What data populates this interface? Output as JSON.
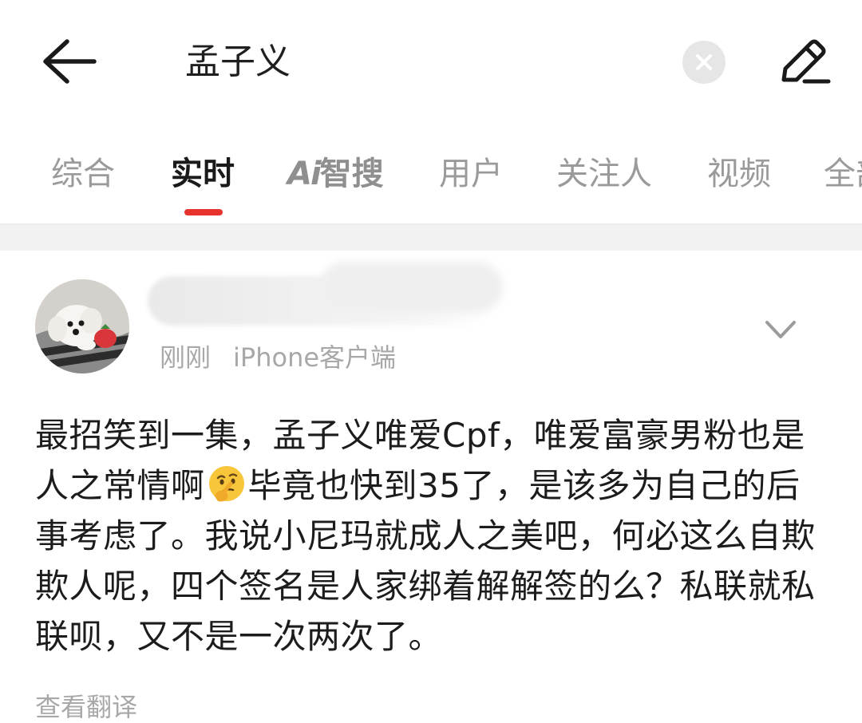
{
  "search": {
    "query": "孟子义"
  },
  "tabs": [
    {
      "label": "综合"
    },
    {
      "label": "实时"
    },
    {
      "label_ai": "Ai",
      "label_rest": "智搜"
    },
    {
      "label": "用户"
    },
    {
      "label": "关注人"
    },
    {
      "label": "视频"
    },
    {
      "label": "全部"
    }
  ],
  "active_tab": "实时",
  "accent_color": "#e8322e",
  "post": {
    "time": "刚刚",
    "source": "iPhone客户端",
    "text_part1": "最招笑到一集，孟子义唯爱Cpf，唯爱富豪男粉也是人之常情啊",
    "emoji": "thinking-face",
    "text_part2": "毕竟也快到35了，是该多为自己的后事考虑了。我说小尼玛就成人之美吧，何必这么自欺欺人呢，四个签名是人家绑着解解签的么？私联就私联呗，又不是一次两次了。",
    "translate_label": "查看翻译"
  }
}
